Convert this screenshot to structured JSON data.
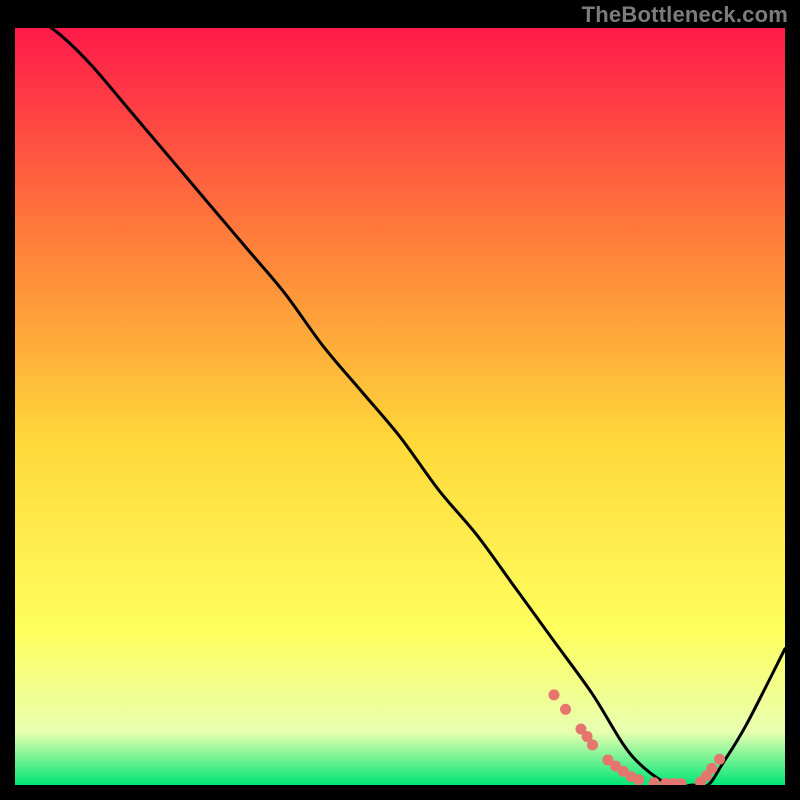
{
  "watermark": "TheBottleneck.com",
  "colors": {
    "frame": "#000000",
    "line": "#000000",
    "marker": "#e5766d",
    "grad_top": "#ff1a4a",
    "grad_mid1": "#ff7e3a",
    "grad_mid2": "#ffd93a",
    "grad_mid3": "#ffff60",
    "grad_mid4": "#e8ffb0",
    "grad_bottom": "#00e676"
  },
  "chart_data": {
    "type": "line",
    "title": "",
    "xlabel": "",
    "ylabel": "",
    "xlim": [
      0,
      100
    ],
    "ylim": [
      0,
      100
    ],
    "series": [
      {
        "name": "curve",
        "x": [
          0,
          2,
          6,
          10,
          15,
          20,
          25,
          30,
          35,
          40,
          45,
          50,
          55,
          60,
          65,
          70,
          75,
          80,
          85,
          88,
          90,
          92,
          95,
          100
        ],
        "y": [
          104,
          102,
          99,
          95,
          89,
          83,
          77,
          71,
          65,
          58,
          52,
          46,
          39,
          33,
          26,
          19,
          12,
          4,
          0,
          0,
          0,
          3,
          8,
          18
        ]
      }
    ],
    "markers": {
      "name": "highlight-points",
      "x": [
        70.0,
        71.5,
        73.5,
        74.3,
        75.0,
        77.0,
        78.0,
        79.0,
        80.0,
        81.0,
        83.0,
        84.5,
        85.5,
        86.5,
        89.0,
        89.8,
        90.5,
        91.5
      ],
      "y": [
        11.9,
        10.0,
        7.4,
        6.4,
        5.3,
        3.3,
        2.5,
        1.8,
        1.1,
        0.7,
        0.3,
        0.2,
        0.2,
        0.2,
        0.4,
        1.2,
        2.2,
        3.4
      ]
    }
  }
}
